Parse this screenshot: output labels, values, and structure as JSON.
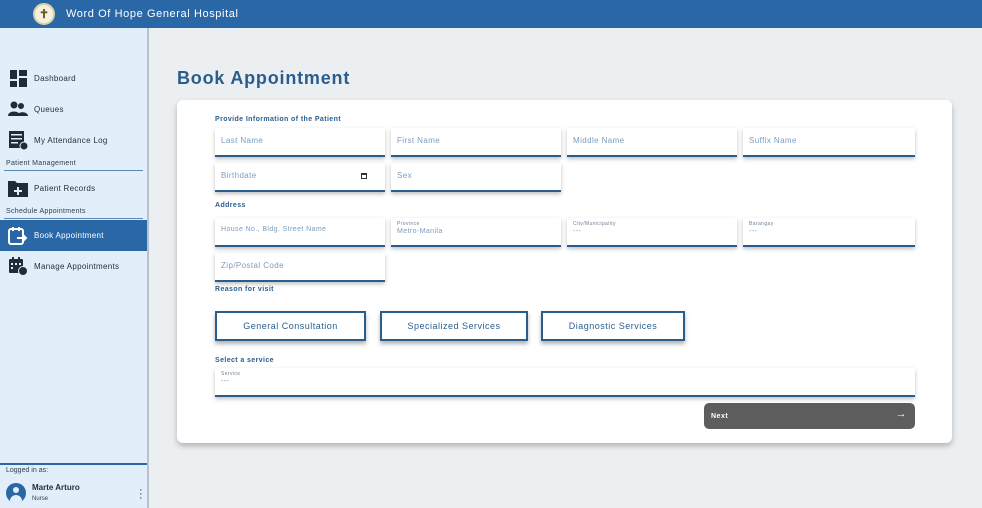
{
  "app": {
    "title": "Word Of Hope General Hospital"
  },
  "sidebar": {
    "items": [
      {
        "label": "Dashboard",
        "icon": "dashboard-icon"
      },
      {
        "label": "Queues",
        "icon": "people-icon"
      },
      {
        "label": "My Attendance Log",
        "icon": "attendance-log-icon"
      },
      {
        "label": "Patient Records",
        "icon": "folder-plus-icon"
      },
      {
        "label": "Book Appointment",
        "icon": "calendar-arrow-icon",
        "active": true
      },
      {
        "label": "Manage Appointments",
        "icon": "calendar-clock-icon"
      }
    ],
    "sections": {
      "patient_management": "Patient Management",
      "schedule_appointments": "Schedule Appointments"
    },
    "login": {
      "label": "Logged in as:",
      "name": "Marte Arturo",
      "role": "Nurse"
    }
  },
  "page": {
    "title": "Book Appointment"
  },
  "form": {
    "patient_info_label": "Provide Information of the Patient",
    "last_name_placeholder": "Last Name",
    "first_name_placeholder": "First Name",
    "middle_name_placeholder": "Middle Name",
    "suffix_name_placeholder": "Suffix Name",
    "birthdate_placeholder": "Birthdate",
    "sex_placeholder": "Sex",
    "address_label": "Address",
    "house_no_placeholder": "House No., Bldg. Street Name",
    "province_label": "Province",
    "province_value": "Metro-Manila",
    "city_label": "City/Municipality",
    "city_value": "---",
    "barangay_label": "Barangay",
    "barangay_value": "---",
    "zip_placeholder": "Zip/Postal Code",
    "reason_label": "Reason for visit",
    "reasons": [
      "General Consultation",
      "Specialized Services",
      "Diagnostic Services"
    ],
    "service_section_label": "Select a service",
    "service_label": "Service",
    "service_value": "---",
    "next_label": "Next"
  },
  "colors": {
    "primary": "#2a67a6",
    "sidebar_bg": "#e3eefb",
    "text_blue": "#2b5d8c",
    "next_button": "#5d5d5d"
  }
}
